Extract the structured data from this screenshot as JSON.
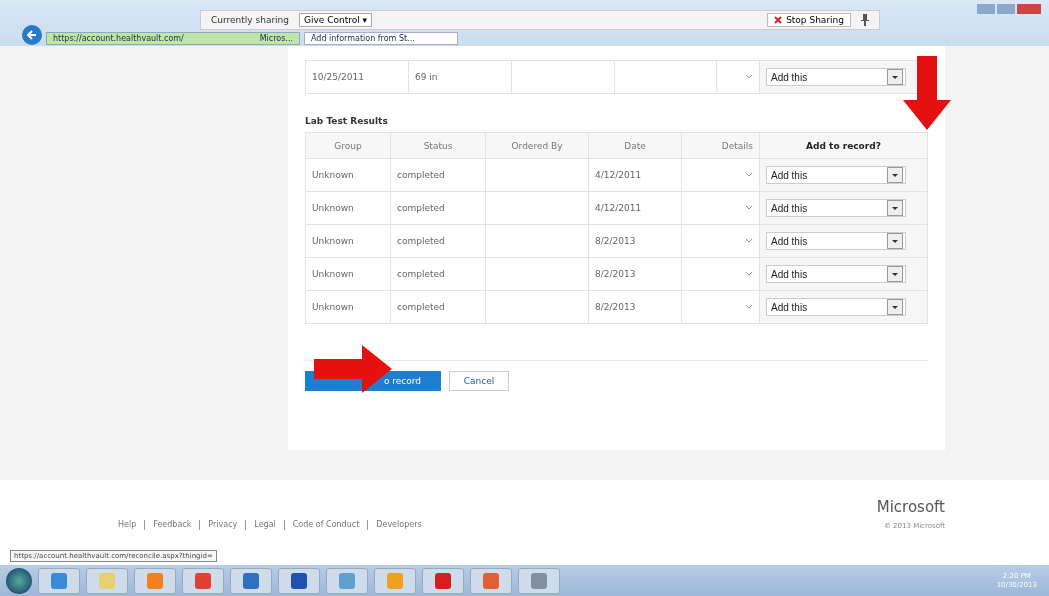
{
  "sharing_bar": {
    "status": "Currently sharing",
    "give_control": "Give Control ▾",
    "stop": "Stop Sharing"
  },
  "browser": {
    "address": "https://account.healthvault.com/",
    "address_tab": "Micros...",
    "tab": "Add information from St..."
  },
  "top_table": {
    "rows": [
      {
        "date": "10/25/2011",
        "height": "69 in",
        "action": "Add this"
      }
    ]
  },
  "lab_results": {
    "title": "Lab Test Results",
    "columns": [
      "Group",
      "Status",
      "Ordered By",
      "Date",
      "Details",
      "Add to record?"
    ],
    "rows": [
      {
        "group": "Unknown",
        "status": "completed",
        "date": "4/12/2011",
        "action": "Add this"
      },
      {
        "group": "Unknown",
        "status": "completed",
        "date": "4/12/2011",
        "action": "Add this"
      },
      {
        "group": "Unknown",
        "status": "completed",
        "date": "8/2/2013",
        "action": "Add this"
      },
      {
        "group": "Unknown",
        "status": "completed",
        "date": "8/2/2013",
        "action": "Add this"
      },
      {
        "group": "Unknown",
        "status": "completed",
        "date": "8/2/2013",
        "action": "Add this"
      }
    ]
  },
  "buttons": {
    "primary": "o record",
    "cancel": "Cancel"
  },
  "footer": {
    "links": [
      "Help",
      "Feedback",
      "Privacy",
      "Legal",
      "Code of Conduct",
      "Developers"
    ],
    "brand": "Microsoft",
    "copyright": "© 2013 Microsoft"
  },
  "status_url": "https://account.healthvault.com/reconcile.aspx?thingid=",
  "taskbar": {
    "time": "2:20 PM",
    "date": "10/30/2013"
  }
}
